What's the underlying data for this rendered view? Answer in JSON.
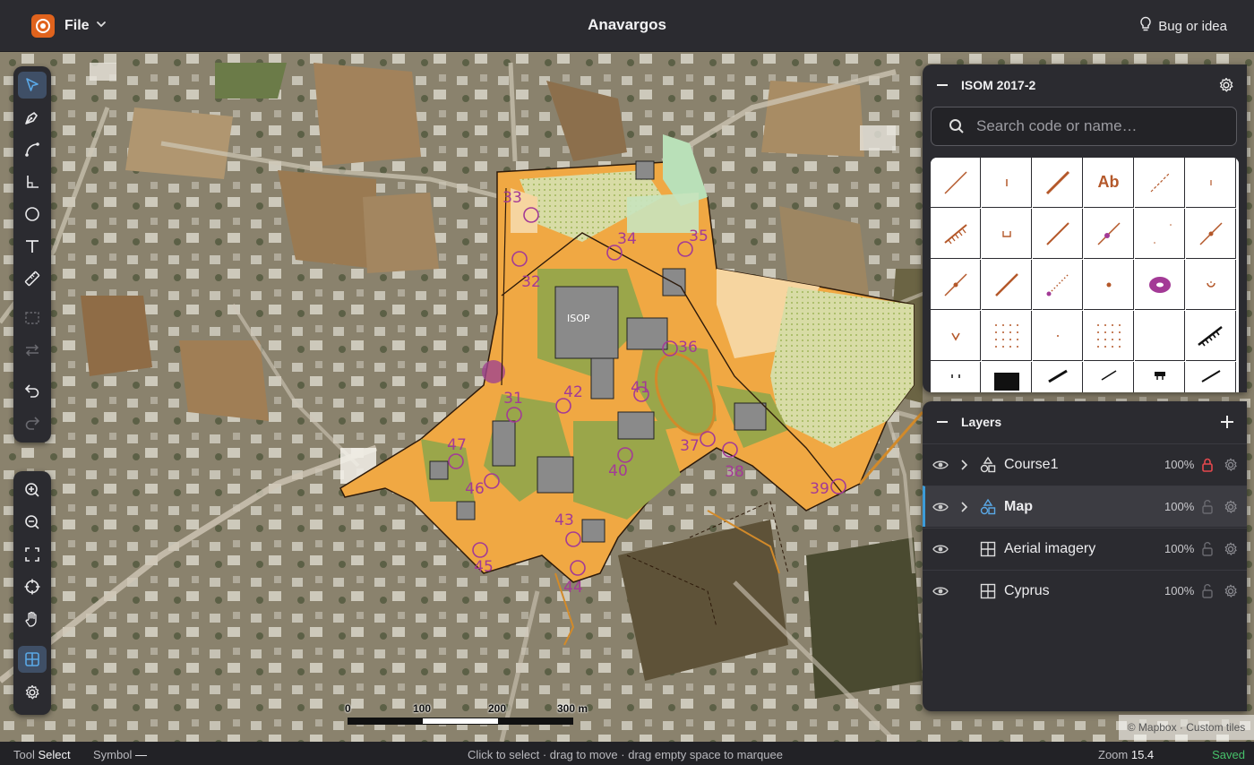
{
  "app": {
    "file_menu_label": "File",
    "document_title": "Anavargos",
    "feedback_label": "Bug or idea",
    "accent_color": "#e0631d"
  },
  "toolbar": {
    "tools": [
      {
        "name": "select",
        "icon": "cursor-arrow-icon",
        "active": true
      },
      {
        "name": "pen",
        "icon": "pen-nib-icon"
      },
      {
        "name": "curve",
        "icon": "bezier-curve-icon"
      },
      {
        "name": "corner",
        "icon": "right-angle-icon"
      },
      {
        "name": "circle",
        "icon": "circle-icon"
      },
      {
        "name": "text",
        "icon": "text-icon"
      },
      {
        "name": "measure",
        "icon": "ruler-icon"
      },
      {
        "name": "rect-select",
        "icon": "dashed-rectangle-icon",
        "disabled": true
      },
      {
        "name": "swap",
        "icon": "swap-arrows-icon",
        "disabled": true
      },
      {
        "name": "undo",
        "icon": "undo-icon"
      },
      {
        "name": "redo",
        "icon": "redo-icon",
        "disabled": true
      }
    ],
    "view_tools": [
      {
        "name": "zoom-in",
        "icon": "zoom-in-icon"
      },
      {
        "name": "zoom-out",
        "icon": "zoom-out-icon"
      },
      {
        "name": "fit",
        "icon": "fullscreen-icon"
      },
      {
        "name": "locate",
        "icon": "crosshair-icon"
      },
      {
        "name": "pan",
        "icon": "hand-icon"
      },
      {
        "name": "grid",
        "icon": "grid-icon",
        "active": true
      },
      {
        "name": "settings",
        "icon": "gear-icon"
      }
    ]
  },
  "symbols": {
    "title": "ISOM 2017-2",
    "search_placeholder": "Search code or name…",
    "ab_label": "Ab",
    "brown": "#b4582a",
    "purple": "#a33a96"
  },
  "layers": {
    "title": "Layers",
    "items": [
      {
        "name": "Course1",
        "opacity": "100%",
        "icon": "shapes-icon",
        "expandable": true,
        "locked": true,
        "selected": false
      },
      {
        "name": "Map",
        "opacity": "100%",
        "icon": "shapes-icon",
        "expandable": true,
        "locked": false,
        "selected": true
      },
      {
        "name": "Aerial imagery",
        "opacity": "100%",
        "icon": "tile-grid-icon",
        "expandable": false,
        "locked": false,
        "selected": false
      },
      {
        "name": "Cyprus",
        "opacity": "100%",
        "icon": "tile-grid-icon",
        "expandable": false,
        "locked": false,
        "selected": false
      }
    ]
  },
  "map": {
    "scale_labels": [
      "0",
      "100",
      "200",
      "300 m"
    ],
    "attribution": "© Mapbox · Custom tiles",
    "isom_label": "ISOP",
    "controls": [
      {
        "number": "32"
      },
      {
        "number": "33"
      },
      {
        "number": "34"
      },
      {
        "number": "35"
      },
      {
        "number": "36"
      },
      {
        "number": "37"
      },
      {
        "number": "38"
      },
      {
        "number": "39"
      },
      {
        "number": "40"
      },
      {
        "number": "41"
      },
      {
        "number": "42"
      },
      {
        "number": "43"
      },
      {
        "number": "44"
      },
      {
        "number": "45"
      },
      {
        "number": "46"
      },
      {
        "number": "47"
      },
      {
        "number": "31"
      }
    ]
  },
  "status": {
    "tool_label": "Tool",
    "tool_value": "Select",
    "symbol_label": "Symbol",
    "symbol_value": "—",
    "hint": "Click to select · drag to move · drag empty space to marquee",
    "zoom_label": "Zoom",
    "zoom_value": "15.4",
    "saved": "Saved"
  }
}
